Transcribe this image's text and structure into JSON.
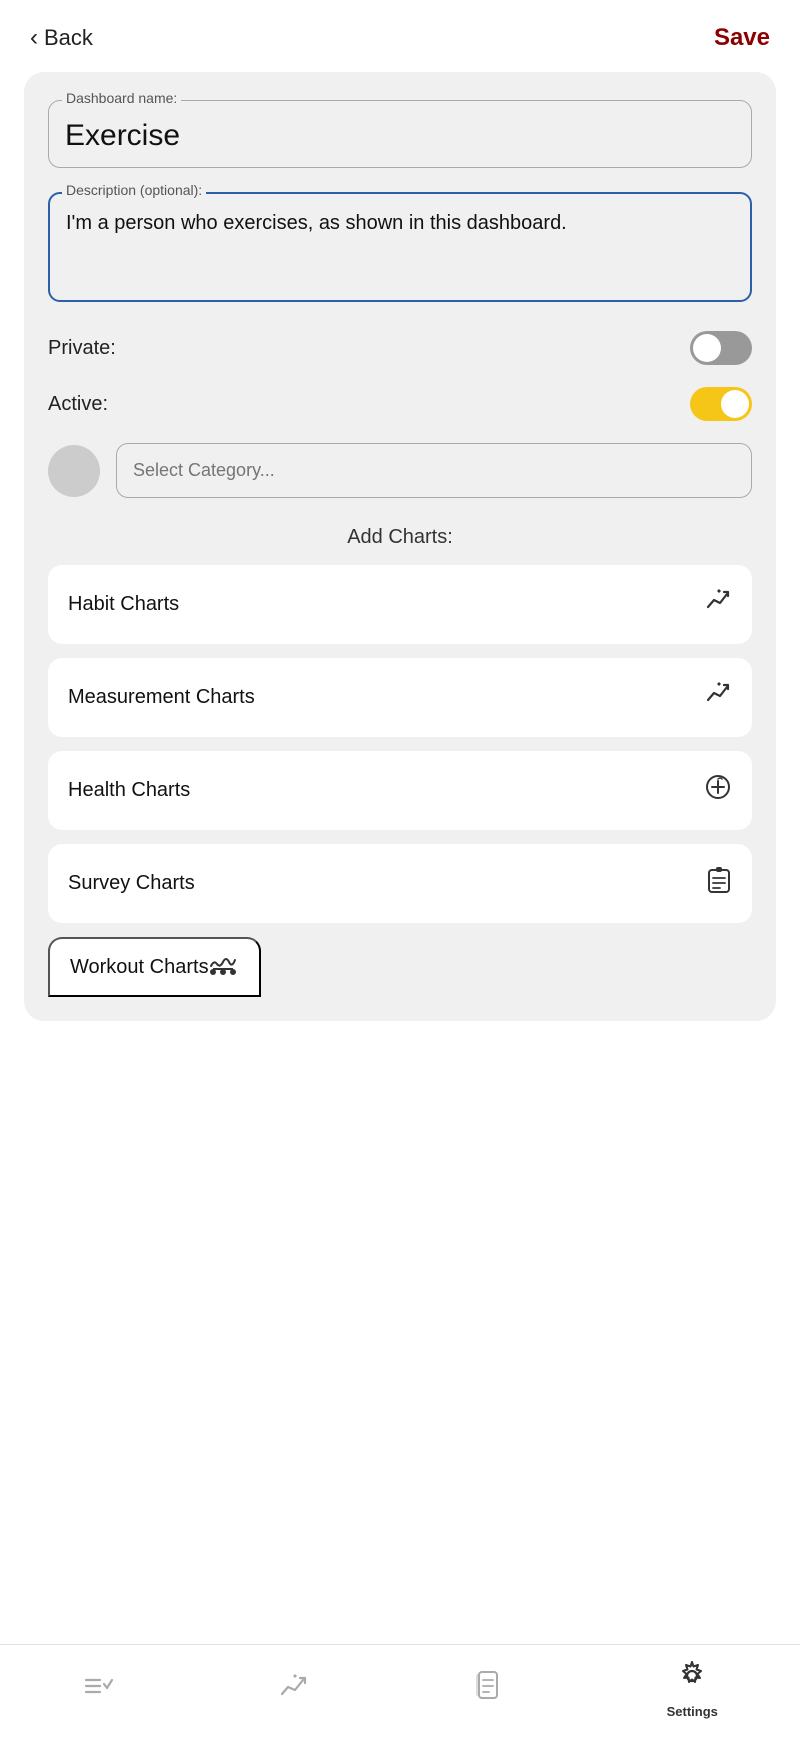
{
  "header": {
    "back_label": "Back",
    "save_label": "Save"
  },
  "form": {
    "dashboard_name_label": "Dashboard name:",
    "dashboard_name_value": "Exercise",
    "description_label": "Description (optional):",
    "description_value": "I'm a person who exercises, as shown in this dashboard.",
    "private_label": "Private:",
    "private_toggle": "off",
    "active_label": "Active:",
    "active_toggle": "on",
    "category_placeholder": "Select Category..."
  },
  "charts": {
    "section_title": "Add Charts:",
    "items": [
      {
        "label": "Habit Charts",
        "icon": "✦↗"
      },
      {
        "label": "Measurement Charts",
        "icon": "✦↗"
      },
      {
        "label": "Health Charts",
        "icon": "⚕"
      },
      {
        "label": "Survey Charts",
        "icon": "📋"
      },
      {
        "label": "Workout Charts",
        "icon": "🏃"
      }
    ]
  },
  "bottom_nav": {
    "items": [
      {
        "label": "",
        "icon": "≡✓",
        "name": "habits-nav"
      },
      {
        "label": "",
        "icon": "✦↗",
        "name": "charts-nav"
      },
      {
        "label": "",
        "icon": "📖",
        "name": "journal-nav"
      },
      {
        "label": "Settings",
        "icon": "⚙",
        "name": "settings-nav",
        "active": true
      }
    ]
  }
}
